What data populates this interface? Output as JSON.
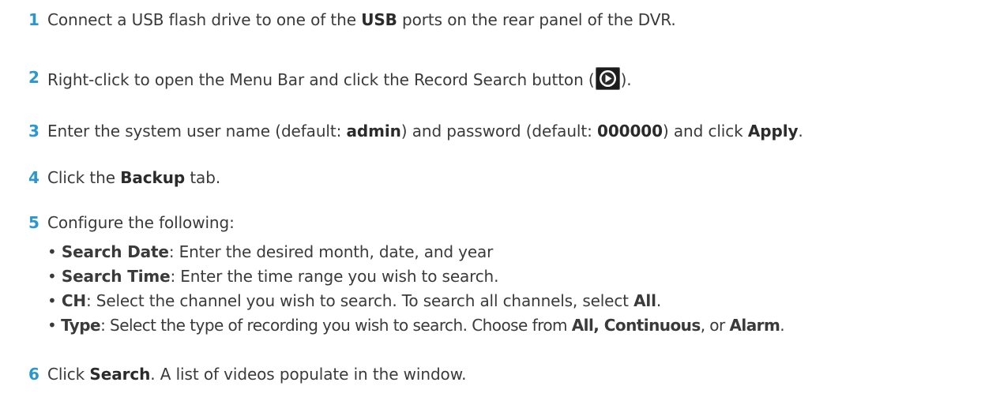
{
  "steps": [
    {
      "num": "1",
      "pre": "Connect a USB flash drive to one of the ",
      "b1": "USB",
      "post": " ports on the rear panel of the DVR."
    },
    {
      "num": "2",
      "pre": "Right-click to open the Menu Bar and click the Record Search button (",
      "icon": "record-search-play-icon",
      "post": ")."
    },
    {
      "num": "3",
      "pre": "Enter the system user name (default: ",
      "b1": "admin",
      "mid1": ") and password (default: ",
      "b2": "000000",
      "mid2": ") and click ",
      "b3": "Apply",
      "post": "."
    },
    {
      "num": "4",
      "pre": "Click the ",
      "b1": "Backup",
      "post": " tab."
    },
    {
      "num": "5",
      "pre": "Configure the following:"
    },
    {
      "num": "6",
      "pre": "Click ",
      "b1": "Search",
      "post": ". A list of videos populate in the window."
    }
  ],
  "options": [
    {
      "bullet": "•",
      "label": "Search Date",
      "text": ": Enter the desired month, date, and year"
    },
    {
      "bullet": "•",
      "label": "Search Time",
      "text": ": Enter the time range you wish to search."
    },
    {
      "bullet": "•",
      "label": "CH",
      "text": ": Select the channel you wish to search. To search all channels, select ",
      "b": "All",
      "tail": "."
    },
    {
      "bullet": "•",
      "label": "Type",
      "text": ": Select the type of recording you wish to search. Choose from ",
      "b": "All, Continuous",
      "mid": ", or ",
      "b2": "Alarm",
      "tail": "."
    }
  ],
  "colors": {
    "step_number": "#2a97cf",
    "body_text": "#3a3a3a"
  }
}
